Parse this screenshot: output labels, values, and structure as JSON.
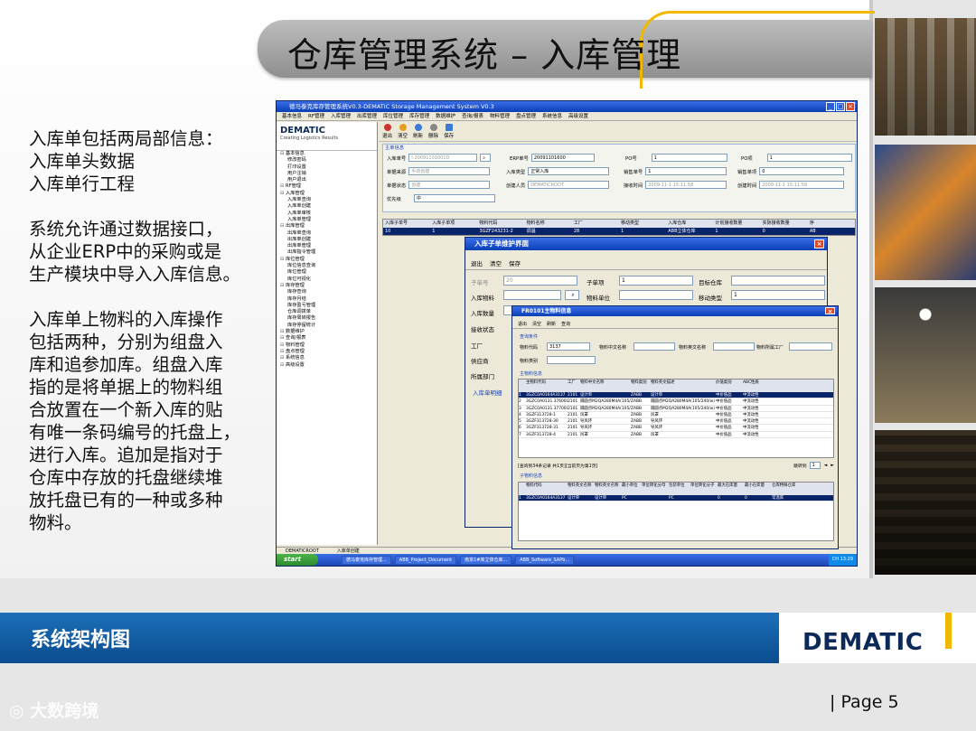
{
  "slide": {
    "title": "仓库管理系统 – 入库管理",
    "para1": [
      "入库单包括两局部信息：",
      "入库单头数据",
      "入库单行工程"
    ],
    "para2": [
      "系统允许通过数据接口，",
      "从企业ERP中的采购或是",
      "生产模块中导入入库信息。"
    ],
    "para3": [
      "入库单上物料的入库操作",
      "包括两种，分别为组盘入",
      "库和追参加库。组盘入库",
      "指的是将单据上的物料组",
      "合放置在一个新入库的贴",
      "有唯一条码编号的托盘上，",
      "进行入库。追加是指对于",
      "仓库中存放的托盘继续堆",
      "放托盘已有的一种或多种",
      "物料。"
    ],
    "footer_title": "系统架构图",
    "logo": "DEMATIC",
    "page_label": "|   Page   5",
    "watermark": "大数跨境"
  },
  "app": {
    "title": "德马泰克库存管理系统V0.3-DEMATIC Storage Management System V0.3",
    "menu": [
      "基本信息",
      "RF管理",
      "入库管理",
      "出库管理",
      "库位管理",
      "库存管理",
      "数据维护",
      "查询/报表",
      "物料管理",
      "盘点管理",
      "系统信息",
      "高级设置"
    ],
    "logo": "DEMATIC",
    "logo_sub": "Creating Logistics Results",
    "tree": [
      {
        "t": "基本信息",
        "lvl": 0
      },
      {
        "t": "修改密码",
        "lvl": 1
      },
      {
        "t": "打印设置",
        "lvl": 1
      },
      {
        "t": "用户注销",
        "lvl": 1
      },
      {
        "t": "用户退出",
        "lvl": 1
      },
      {
        "t": "RF管理",
        "lvl": 0
      },
      {
        "t": "入库管理",
        "lvl": 0
      },
      {
        "t": "入库单查询",
        "lvl": 1
      },
      {
        "t": "入库单创建",
        "lvl": 1
      },
      {
        "t": "入库单审核",
        "lvl": 1
      },
      {
        "t": "入库单管理",
        "lvl": 1
      },
      {
        "t": "出库管理",
        "lvl": 0
      },
      {
        "t": "出库单查询",
        "lvl": 1
      },
      {
        "t": "出库单创建",
        "lvl": 1
      },
      {
        "t": "出库单管理",
        "lvl": 1
      },
      {
        "t": "出库指令管理",
        "lvl": 1
      },
      {
        "t": "库位管理",
        "lvl": 0
      },
      {
        "t": "库位信息查询",
        "lvl": 1
      },
      {
        "t": "库位管理",
        "lvl": 1
      },
      {
        "t": "库位可视化",
        "lvl": 1
      },
      {
        "t": "库存管理",
        "lvl": 0
      },
      {
        "t": "库存查询",
        "lvl": 1
      },
      {
        "t": "库存月结",
        "lvl": 1
      },
      {
        "t": "库存盈亏管理",
        "lvl": 1
      },
      {
        "t": "仓库调拨单",
        "lvl": 1
      },
      {
        "t": "库存周转报告",
        "lvl": 1
      },
      {
        "t": "库存停留统计",
        "lvl": 1
      },
      {
        "t": "数据维护",
        "lvl": 0
      },
      {
        "t": "查询/报表",
        "lvl": 0
      },
      {
        "t": "物料管理",
        "lvl": 0
      },
      {
        "t": "盘点管理",
        "lvl": 0
      },
      {
        "t": "系统信息",
        "lvl": 0
      },
      {
        "t": "高级设置",
        "lvl": 0
      }
    ],
    "toolbar": [
      "退出",
      "清空",
      "刷新",
      "删除",
      "保存"
    ],
    "form_section": "主单信息",
    "fields": {
      "in_no_label": "入库单号",
      "in_no": "I-20091101001D",
      "erp_label": "ERP单号",
      "erp": "20091101600",
      "po_label": "PO号",
      "po": "1",
      "po_item_label": "PO项",
      "po_item": "1",
      "src_label": "单据来源",
      "src": "手动创建",
      "type_label": "入库类型",
      "type": "正常入库",
      "sale_label": "销售单号",
      "sale": "1",
      "sale_item_label": "销售单项",
      "sale_item": "0",
      "status_label": "单据状态",
      "status": "创建",
      "creator_label": "创建人员",
      "creator": "DEMATICROOT",
      "recv_label": "接收时间",
      "recv": "2009-11-1 15:11:58",
      "create_label": "创建时间",
      "create": "2009-11-1 15:11:58",
      "prio_label": "优先级",
      "prio": "中"
    },
    "grid_headers": [
      "入库子单号",
      "入库子单项",
      "物料代码",
      "物料名称",
      "工厂",
      "移动类型",
      "入库仓库",
      "计划接收数量",
      "实际接收数量",
      "序"
    ],
    "grid_row": [
      "10",
      "1",
      "3GZF243231-2",
      "调温",
      "28",
      "1",
      "ABB立体仓库",
      "1",
      "0",
      "AB"
    ],
    "status_left": "DEMATICROOT",
    "status_mid": "入库单创建",
    "taskbar": {
      "start": "start",
      "tasks": [
        "德马泰克库存管理...",
        "ABB_Project_Document",
        "南京1#库立体仓库...",
        "ABB_Software_SAPb..."
      ],
      "tray": "CH  13:29"
    }
  },
  "dialog1": {
    "title": "入库子单维护界面",
    "toolbar": [
      "退出",
      "清空",
      "保存"
    ],
    "sub_no_label": "子单号",
    "sub_no": "20",
    "sub_item_label": "子单项",
    "sub_item": "1",
    "target_label": "目标仓库",
    "material_label": "入库物料",
    "unit_label": "物料单位",
    "move_label": "移动类型",
    "move": "1",
    "qty_label": "入库数量",
    "recv_label": "接收状态",
    "factory_label": "工厂",
    "supplier_label": "供应商",
    "dept_label": "所属部门",
    "detail_label": "入库单明细"
  },
  "dialog2": {
    "title": "FR0101主物料信息",
    "toolbar": [
      "退出",
      "清空",
      "刷新",
      "查询"
    ],
    "query_section": "查询条件",
    "f_code_label": "物料代码",
    "f_code": "3137",
    "f_cn_label": "物料中文名称",
    "f_en_label": "物料英文名称",
    "f_factory_label": "物料所属工厂",
    "f_type_label": "物料类别",
    "list_section": "主物料信息",
    "headers": [
      "主物料代码",
      "工厂",
      "物料中文名称",
      "物料类别",
      "物料英文描述",
      "价值类别",
      "ABC性质"
    ],
    "rows": [
      [
        "1",
        "3GZC0A0164A3137",
        "2101",
        "设计单",
        "ZABB",
        "设计单",
        "中价值品",
        "中流动性"
      ],
      [
        "2",
        "3GZC0A0131.3760000",
        "2101",
        "隔圆点M2QA280M4A(105/240/w)",
        "ZABB",
        "隔圆点M2QA280M4A(105/240/w)",
        "中价值品",
        "中流动性"
      ],
      [
        "3",
        "3GZC0A0131.3770000",
        "2101",
        "隔圆点M2QA280M4A(105/240/w)",
        "ZABB",
        "隔圆点M2QA280M4A(105/240/w)",
        "中价值品",
        "中流动性"
      ],
      [
        "4",
        "3GZF313728-1",
        "2101",
        "风罩",
        "ZABB",
        "风罩",
        "中价值品",
        "中流动性"
      ],
      [
        "5",
        "3GZF313728-30",
        "2101",
        "导风环",
        "ZABB",
        "导风环",
        "中价值品",
        "中流动性"
      ],
      [
        "6",
        "3GZF313728-31",
        "2101",
        "导风环",
        "ZABB",
        "导风环",
        "中价值品",
        "中流动性"
      ],
      [
        "7",
        "3GZF313728-4",
        "2101",
        "风罩",
        "ZABB",
        "风罩",
        "中价值品",
        "中流动性"
      ]
    ],
    "pager": "[查询到34条记录 共1页][当前页为第1页]",
    "jump_label": "跳转到",
    "jump_val": "1",
    "sub_section": "子物料信息",
    "sub_headers": [
      "物料代码",
      "物料英文名称",
      "物料英文名称",
      "最小单位",
      "单位转化分母",
      "包装单位",
      "单位转化分子",
      "最大在库量",
      "最小在库量",
      "仓库特殊仓库"
    ],
    "sub_row": [
      "1",
      "3GZC0A0164A3137",
      "设计单",
      "设计单",
      "PC",
      "",
      "PC",
      "",
      "0",
      "0",
      "常温库"
    ]
  }
}
